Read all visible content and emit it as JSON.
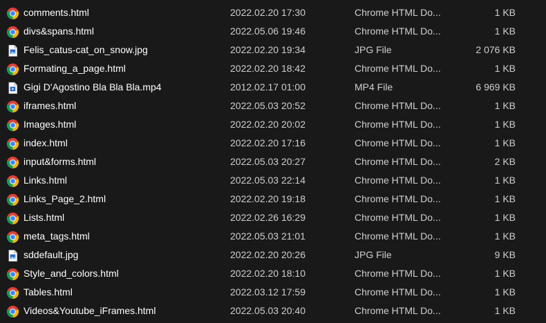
{
  "files": [
    {
      "name": "comments.html",
      "date": "2022.02.20 17:30",
      "type": "Chrome HTML Do...",
      "size": "1 KB",
      "icon": "chrome-icon"
    },
    {
      "name": "divs&spans.html",
      "date": "2022.05.06 19:46",
      "type": "Chrome HTML Do...",
      "size": "1 KB",
      "icon": "chrome-icon"
    },
    {
      "name": "Felis_catus-cat_on_snow.jpg",
      "date": "2022.02.20 19:34",
      "type": "JPG File",
      "size": "2 076 KB",
      "icon": "image-file-icon"
    },
    {
      "name": "Formating_a_page.html",
      "date": "2022.02.20 18:42",
      "type": "Chrome HTML Do...",
      "size": "1 KB",
      "icon": "chrome-icon"
    },
    {
      "name": "Gigi D'Agostino Bla Bla Bla.mp4",
      "date": "2012.02.17 01:00",
      "type": "MP4 File",
      "size": "6 969 KB",
      "icon": "video-file-icon"
    },
    {
      "name": "iframes.html",
      "date": "2022.05.03 20:52",
      "type": "Chrome HTML Do...",
      "size": "1 KB",
      "icon": "chrome-icon"
    },
    {
      "name": "Images.html",
      "date": "2022.02.20 20:02",
      "type": "Chrome HTML Do...",
      "size": "1 KB",
      "icon": "chrome-icon"
    },
    {
      "name": "index.html",
      "date": "2022.02.20 17:16",
      "type": "Chrome HTML Do...",
      "size": "1 KB",
      "icon": "chrome-icon"
    },
    {
      "name": "input&forms.html",
      "date": "2022.05.03 20:27",
      "type": "Chrome HTML Do...",
      "size": "2 KB",
      "icon": "chrome-icon"
    },
    {
      "name": "Links.html",
      "date": "2022.05.03 22:14",
      "type": "Chrome HTML Do...",
      "size": "1 KB",
      "icon": "chrome-icon"
    },
    {
      "name": "Links_Page_2.html",
      "date": "2022.02.20 19:18",
      "type": "Chrome HTML Do...",
      "size": "1 KB",
      "icon": "chrome-icon"
    },
    {
      "name": "Lists.html",
      "date": "2022.02.26 16:29",
      "type": "Chrome HTML Do...",
      "size": "1 KB",
      "icon": "chrome-icon"
    },
    {
      "name": "meta_tags.html",
      "date": "2022.05.03 21:01",
      "type": "Chrome HTML Do...",
      "size": "1 KB",
      "icon": "chrome-icon"
    },
    {
      "name": "sddefault.jpg",
      "date": "2022.02.20 20:26",
      "type": "JPG File",
      "size": "9 KB",
      "icon": "image-file-icon"
    },
    {
      "name": "Style_and_colors.html",
      "date": "2022.02.20 18:10",
      "type": "Chrome HTML Do...",
      "size": "1 KB",
      "icon": "chrome-icon"
    },
    {
      "name": "Tables.html",
      "date": "2022.03.12 17:59",
      "type": "Chrome HTML Do...",
      "size": "1 KB",
      "icon": "chrome-icon"
    },
    {
      "name": "Videos&Youtube_iFrames.html",
      "date": "2022.05.03 20:40",
      "type": "Chrome HTML Do...",
      "size": "1 KB",
      "icon": "chrome-icon"
    }
  ],
  "colors": {
    "background": "#191919",
    "text": "#ffffff",
    "secondary_text": "#cfcfcf",
    "chrome_red": "#db4437",
    "chrome_green": "#0f9d58",
    "chrome_yellow": "#f4b400",
    "chrome_blue": "#4285f4",
    "file_blue": "#2b6cc4"
  }
}
